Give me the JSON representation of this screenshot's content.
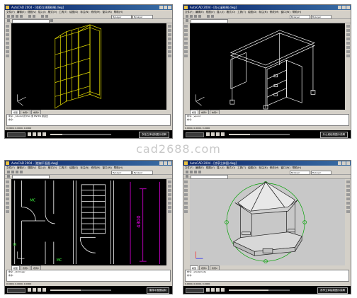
{
  "watermark": "cad2688.com",
  "menu_items": [
    "文件(F)",
    "编辑(E)",
    "视图(V)",
    "插入(I)",
    "格式(O)",
    "工具(T)",
    "绘图(D)",
    "标注(N)",
    "修改(M)",
    "窗口(W)",
    "帮助(H)"
  ],
  "panels": [
    {
      "title": "AutoCAD 2004 - [衣柜立体图绘制.dwg]",
      "layer": "ByLayer",
      "tabs": [
        "模型",
        "布局1",
        "布局2"
      ],
      "command_lines": [
        "命令: _3dorbit 按 ESC 或 ENTER 键退出",
        "命令:"
      ],
      "status": "0.0000, 0.0000, 0.0000",
      "task_label": "衣柜立体绘制图示讲解",
      "progress": 0.2,
      "drawing": "wardrobe"
    },
    {
      "title": "AutoCAD 2004 - [办公桌绘制.dwg]",
      "layer": "ByLayer",
      "tabs": [
        "模型",
        "布局1",
        "布局2"
      ],
      "command_lines": [
        "命令: _vpoint",
        "命令:"
      ],
      "status": "0.0000, 0.0000, 0.0000",
      "task_label": "办公桌绘制图示讲解",
      "progress": 0.35,
      "drawing": "desk"
    },
    {
      "title": "AutoCAD 2004 - [楼梯平面图.dwg]",
      "layer": "ByLayer",
      "tabs": [
        "模型",
        "布局1",
        "布局2"
      ],
      "command_lines": [
        "命令: _dimlinear",
        "命令:"
      ],
      "status": "0.0000, 0.0000, 0.0000",
      "task_label": "楼梯平面图绘制",
      "progress": 0.5,
      "drawing": "plan",
      "dim_label": "4300"
    },
    {
      "title": "AutoCAD 2004 - [凉亭立体图.dwg]",
      "layer": "ByLayer",
      "tabs": [
        "模型",
        "布局1",
        "布局2"
      ],
      "command_lines": [
        "命令: _shademode",
        "命令:"
      ],
      "status": "0.0000, 0.0000, 0.0000",
      "task_label": "凉亭立体绘制图示讲解",
      "progress": 0.65,
      "drawing": "pavilion"
    }
  ],
  "colors": {
    "title_bar": "#0a246a",
    "chrome": "#d4d0c8",
    "canvas_dark": "#000000",
    "canvas_light": "#c8c8c8",
    "wardrobe_lines": "#e8e000",
    "desk_lines": "#ffffff",
    "plan_lines": "#ffffff",
    "plan_dims": "#ff00ff",
    "plan_text": "#40ff40",
    "pavilion_lines": "#202020",
    "orbit_circle": "#00a000"
  }
}
